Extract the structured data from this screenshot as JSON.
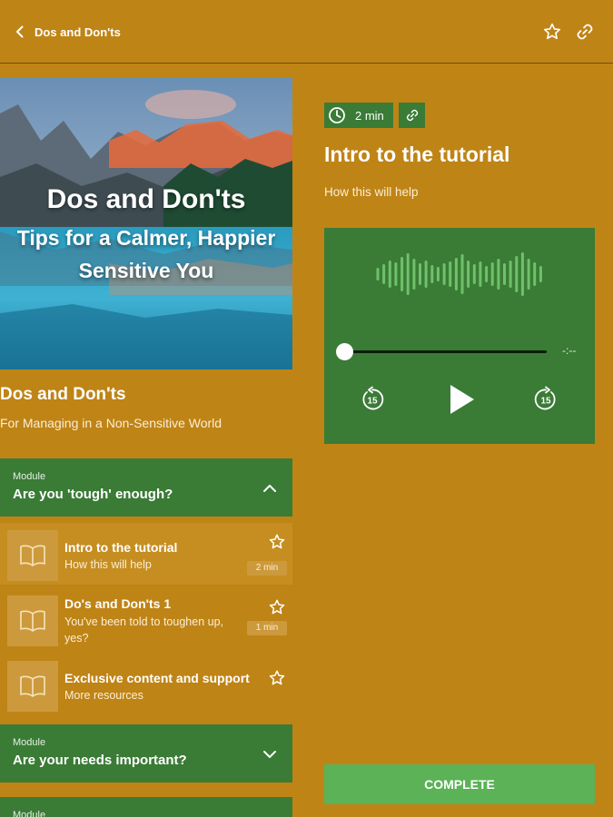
{
  "header": {
    "back_label": "Dos and Don'ts",
    "icons": [
      "chevron-left-icon",
      "star-outline-icon",
      "link-icon"
    ]
  },
  "hero": {
    "title": "Dos and Don'ts",
    "subtitle_line1": "Tips for a Calmer, Happier",
    "subtitle_line2": "Sensitive You"
  },
  "course": {
    "title": "Dos and Don'ts",
    "subtitle": "For Managing in a Non-Sensitive World"
  },
  "modules": [
    {
      "label": "Module",
      "title": "Are you 'tough' enough?",
      "expanded": true
    },
    {
      "label": "Module",
      "title": "Are your needs important?",
      "expanded": false
    },
    {
      "label": "Module",
      "title": "",
      "expanded": false
    }
  ],
  "lessons": [
    {
      "title": "Intro to the tutorial",
      "subtitle": "How this will help",
      "duration": "2 min",
      "active": true
    },
    {
      "title": "Do's and Don'ts 1",
      "subtitle": "You've been told to toughen up, yes?",
      "duration": "1 min",
      "active": false
    },
    {
      "title": "Exclusive content and support",
      "subtitle": "More resources",
      "duration": "",
      "active": false
    }
  ],
  "detail": {
    "duration": "2 min",
    "title": "Intro to the tutorial",
    "subtitle": "How this will help"
  },
  "player": {
    "time_remaining": "-:--",
    "progress": 0,
    "skip_back_label": "15",
    "skip_forward_label": "15"
  },
  "actions": {
    "complete_label": "COMPLETE"
  },
  "colors": {
    "background": "#BF8416",
    "module_green": "#3A7B36",
    "button_green": "#5BB257",
    "wave_green": "#6FC16A",
    "thumb_tan": "#CC9A3C"
  }
}
